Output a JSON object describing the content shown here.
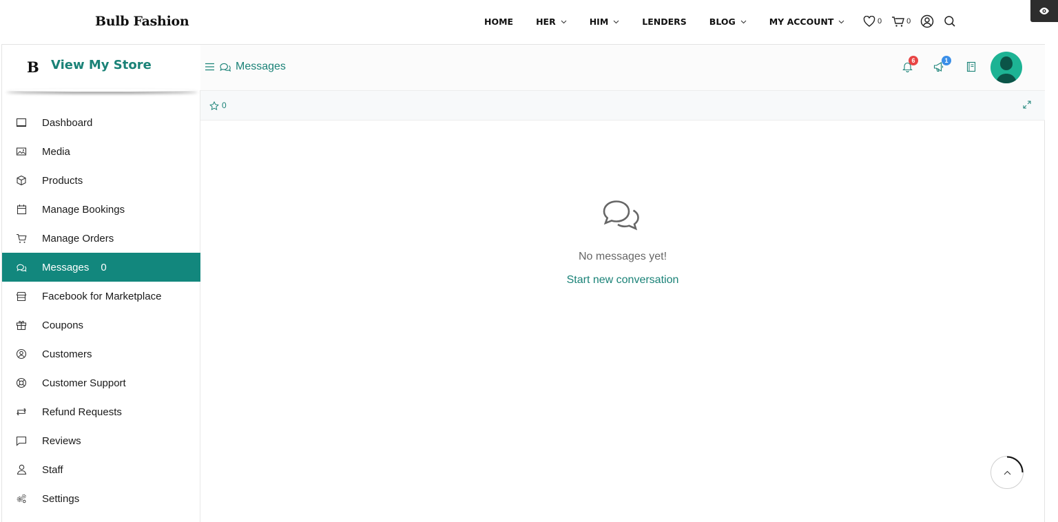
{
  "site": {
    "brand": "Bulb Fashion",
    "nav": [
      {
        "label": "HOME",
        "dropdown": false
      },
      {
        "label": "HER",
        "dropdown": true
      },
      {
        "label": "HIM",
        "dropdown": true
      },
      {
        "label": "LENDERS",
        "dropdown": false
      },
      {
        "label": "BLOG",
        "dropdown": true
      },
      {
        "label": "MY ACCOUNT",
        "dropdown": true
      }
    ],
    "wishlist_count": "0",
    "cart_count": "0"
  },
  "store": {
    "logo_letter": "B",
    "title": "View My Store"
  },
  "sidebar": {
    "items": [
      {
        "label": "Dashboard",
        "icon": "monitor-icon"
      },
      {
        "label": "Media",
        "icon": "image-icon"
      },
      {
        "label": "Products",
        "icon": "box-icon"
      },
      {
        "label": "Manage Bookings",
        "icon": "calendar-icon"
      },
      {
        "label": "Manage Orders",
        "icon": "cart-icon"
      },
      {
        "label": "Messages",
        "icon": "chat-icon",
        "count": "0",
        "active": true
      },
      {
        "label": "Facebook for Marketplace",
        "icon": "store-icon"
      },
      {
        "label": "Coupons",
        "icon": "gift-icon"
      },
      {
        "label": "Customers",
        "icon": "user-circle-icon"
      },
      {
        "label": "Customer Support",
        "icon": "lifebuoy-icon"
      },
      {
        "label": "Refund Requests",
        "icon": "refund-icon"
      },
      {
        "label": "Reviews",
        "icon": "comment-icon"
      },
      {
        "label": "Staff",
        "icon": "user-icon"
      },
      {
        "label": "Settings",
        "icon": "gears-icon"
      }
    ]
  },
  "topbar": {
    "page_title": "Messages",
    "notifications_count": "6",
    "announcements_count": "1"
  },
  "subbar": {
    "starred_count": "0"
  },
  "empty": {
    "message": "No messages yet!",
    "action": "Start new conversation"
  },
  "colors": {
    "accent": "#12877d",
    "link": "#1a8277",
    "notification_badge": "#e84545",
    "announcement_badge": "#3b8fe8",
    "avatar": "#1db394"
  }
}
